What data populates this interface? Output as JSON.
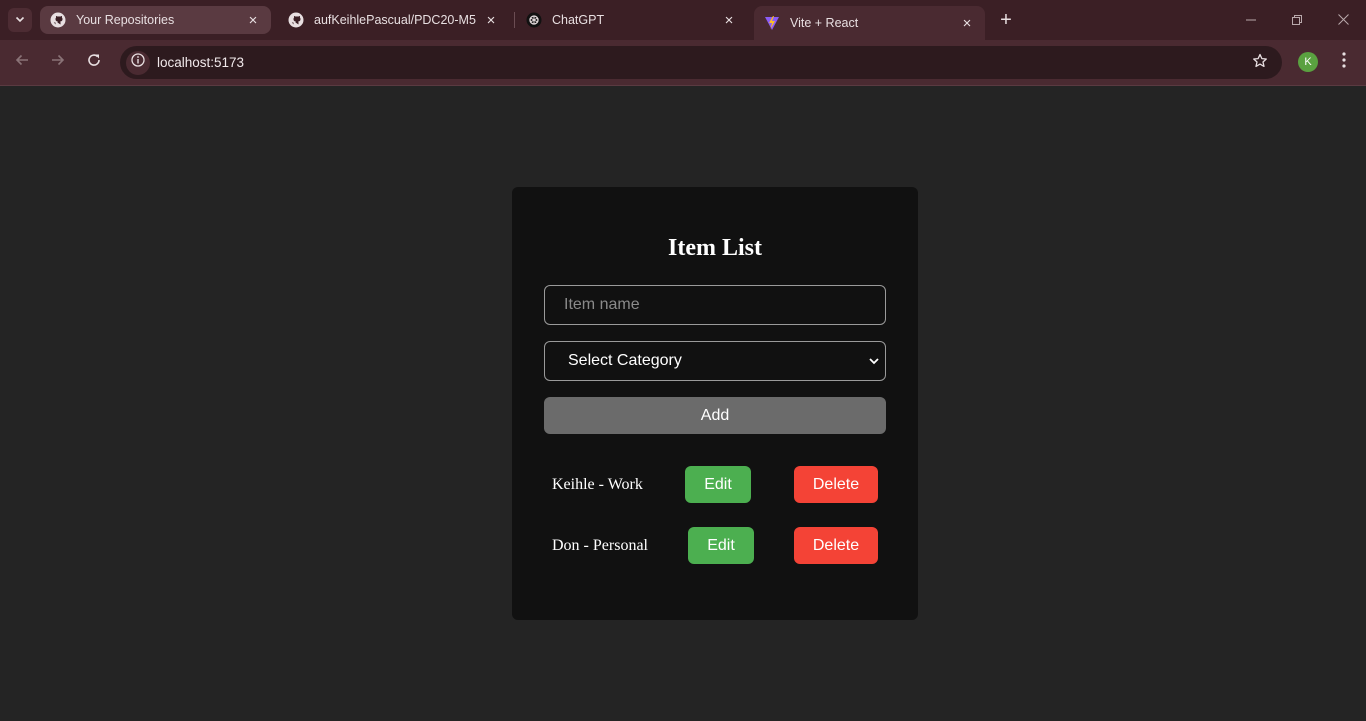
{
  "browser": {
    "tabs": [
      {
        "label": "Your Repositories",
        "icon": "github-icon"
      },
      {
        "label": "aufKeihlePascual/PDC20-M5",
        "icon": "github-icon"
      },
      {
        "label": "ChatGPT",
        "icon": "chatgpt-icon"
      },
      {
        "label": "Vite + React",
        "icon": "vite-icon",
        "active": true
      }
    ],
    "url": "localhost:5173",
    "profile_initial": "K"
  },
  "app": {
    "title": "Item List",
    "item_input": {
      "value": "",
      "placeholder": "Item name"
    },
    "category_select": {
      "selected": "Select Category"
    },
    "add_label": "Add",
    "items": [
      {
        "label": "Keihle - Work",
        "edit_label": "Edit",
        "delete_label": "Delete"
      },
      {
        "label": "Don - Personal",
        "edit_label": "Edit",
        "delete_label": "Delete"
      }
    ]
  },
  "colors": {
    "edit": "#4caf50",
    "delete": "#f44336",
    "add": "#6b6b6b",
    "card": "#111111",
    "page": "#242424"
  }
}
